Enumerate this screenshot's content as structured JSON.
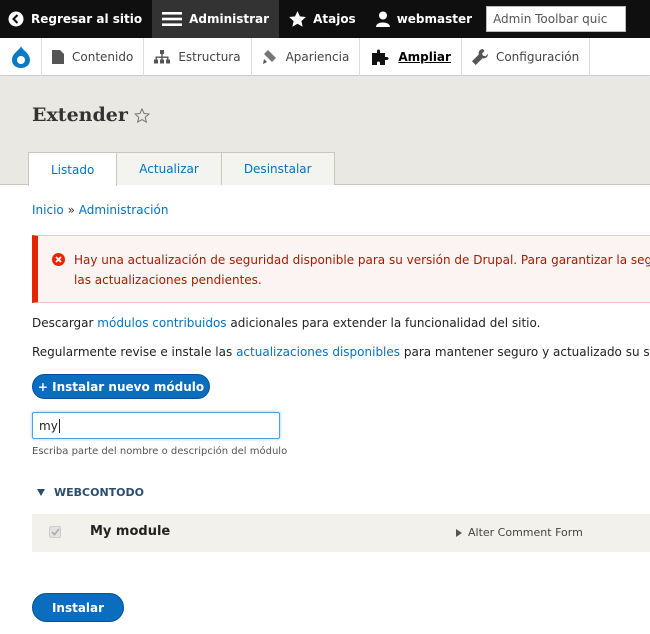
{
  "toolbar": {
    "back_label": "Regresar al sitio",
    "admin_label": "Administrar",
    "shortcuts_label": "Atajos",
    "user_label": "webmaster",
    "search_placeholder": "Admin Toolbar quic"
  },
  "tray": {
    "items": [
      {
        "label": "Contenido"
      },
      {
        "label": "Estructura"
      },
      {
        "label": "Apariencia"
      },
      {
        "label": "Ampliar"
      },
      {
        "label": "Configuración"
      }
    ]
  },
  "header": {
    "title": "Extender",
    "tabs": [
      {
        "label": "Listado"
      },
      {
        "label": "Actualizar"
      },
      {
        "label": "Desinstalar"
      }
    ]
  },
  "breadcrumb": {
    "home": "Inicio",
    "separator": "»",
    "admin": "Administración"
  },
  "message": {
    "line1": "Hay una actualización de seguridad disponible para su versión de Drupal. Para garantizar la seg",
    "line2": "las actualizaciones pendientes."
  },
  "intro": {
    "p1_prefix": "Descargar",
    "p1_link": "módulos contribuidos",
    "p1_suffix": "adicionales para extender la funcionalidad del sitio.",
    "p2_prefix": "Regularmente revise e instale las",
    "p2_link": "actualizaciones disponibles",
    "p2_suffix": "para mantener seguro y actualizado su s"
  },
  "add_module_button": "+ Instalar nuevo módulo",
  "filter": {
    "value": "my",
    "help": "Escriba parte del nombre o descripción del módulo"
  },
  "package": {
    "name": "WEBCONTODO",
    "modules": [
      {
        "name": "My module",
        "description": "Alter Comment Form",
        "checked": true,
        "disabled": true
      }
    ]
  },
  "install_button": "Instalar",
  "colors": {
    "accent": "#0074bd",
    "toolbar_bg": "#0f0f0f",
    "error": "#e62600",
    "button": "#0a6dbd"
  }
}
